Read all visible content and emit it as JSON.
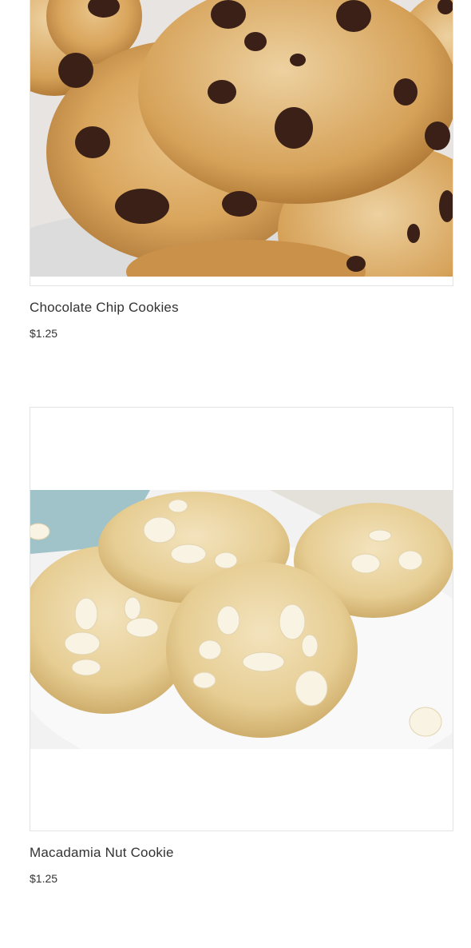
{
  "products": [
    {
      "name": "Chocolate Chip Cookies",
      "price": "$1.25",
      "image_subject": "chocolate chip cookies"
    },
    {
      "name": "Macadamia Nut Cookie",
      "price": "$1.25",
      "image_subject": "white chocolate macadamia nut cookies"
    }
  ],
  "colors": {
    "cookie_golden": "#d9a55c",
    "cookie_pale": "#ecd7a4",
    "chocolate": "#3a2016",
    "white_chip": "#f7f2e2",
    "plate": "#eeeeee",
    "text": "#333333",
    "frame_border": "#e3e3e3"
  }
}
